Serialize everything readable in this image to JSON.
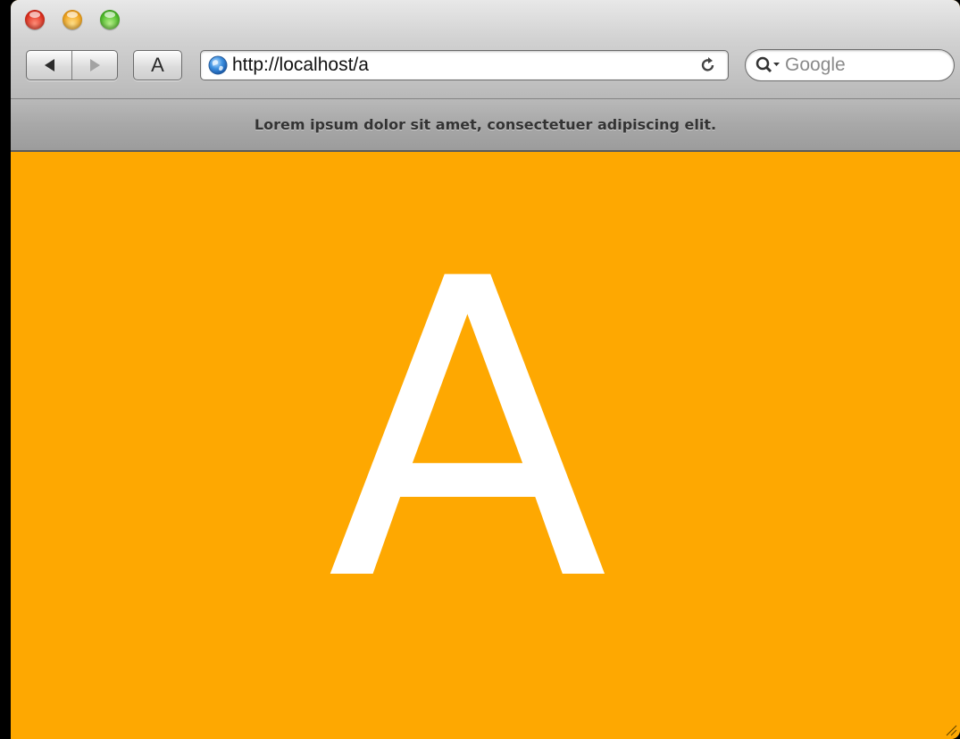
{
  "browser": {
    "text_button_label": "A",
    "address": {
      "url": "http://localhost/a"
    },
    "search": {
      "placeholder": "Google"
    },
    "bookmarks_bar": {
      "text": "Lorem ipsum dolor sit amet, consectetuer adipiscing elit."
    }
  },
  "page": {
    "letter": "A",
    "background_color": "#fea801",
    "letter_color": "#ffffff"
  }
}
